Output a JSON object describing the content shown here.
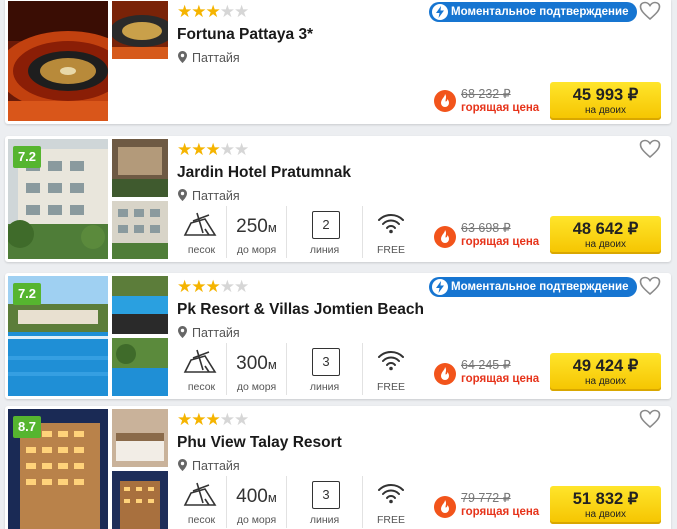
{
  "hotels": [
    {
      "name": "Fortuna Pattaya 3*",
      "location": "Паттайя",
      "stars": 3,
      "rating": "",
      "badge": "Моментальное подтверждение",
      "old_price": "68 232 ₽",
      "hot_label": "горящая цена",
      "price": "45 993 ₽",
      "price_note": "на двоих",
      "features": null
    },
    {
      "name": "Jardin Hotel Pratumnak",
      "location": "Паттайя",
      "stars": 3,
      "rating": "7.2",
      "badge": "",
      "old_price": "63 698 ₽",
      "hot_label": "горящая цена",
      "price": "48 642 ₽",
      "price_note": "на двоих",
      "features": {
        "beach_label": "песок",
        "distance": "250",
        "distance_unit": "м",
        "distance_label": "до моря",
        "line": "2",
        "line_label": "линия",
        "wifi_label": "FREE"
      }
    },
    {
      "name": "Pk Resort & Villas Jomtien Beach",
      "location": "Паттайя",
      "stars": 3,
      "rating": "7.2",
      "badge": "Моментальное подтверждение",
      "old_price": "64 245 ₽",
      "hot_label": "горящая цена",
      "price": "49 424 ₽",
      "price_note": "на двоих",
      "features": {
        "beach_label": "песок",
        "distance": "300",
        "distance_unit": "м",
        "distance_label": "до моря",
        "line": "3",
        "line_label": "линия",
        "wifi_label": "FREE"
      }
    },
    {
      "name": "Phu View Talay Resort",
      "location": "Паттайя",
      "stars": 3,
      "rating": "8.7",
      "badge": "",
      "old_price": "79 772 ₽",
      "hot_label": "горящая цена",
      "price": "51 832 ₽",
      "price_note": "на двоих",
      "features": {
        "beach_label": "песок",
        "distance": "400",
        "distance_unit": "м",
        "distance_label": "до моря",
        "line": "3",
        "line_label": "линия",
        "wifi_label": "FREE"
      }
    }
  ],
  "colors": {
    "rating": "#56b52f",
    "star": "#f5b400",
    "badge": "#1675d1",
    "hot": "#e6331a",
    "price_button": "#ffd91a"
  },
  "icons": [
    "map-pin-icon",
    "heart-icon",
    "lightning-icon",
    "fire-icon",
    "beach-sand-icon",
    "wifi-icon"
  ]
}
